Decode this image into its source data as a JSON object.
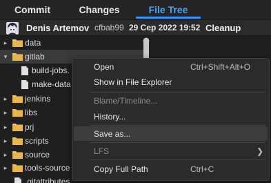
{
  "tabs": [
    {
      "label": "Commit"
    },
    {
      "label": "Changes"
    },
    {
      "label": "File Tree"
    }
  ],
  "commit": {
    "author": "Denis Artemov",
    "hash": "cfbab99",
    "date": "29 Cep 2022 19:52",
    "message": "Cleanup"
  },
  "tree": [
    {
      "label": "data",
      "type": "folder",
      "expanded": false
    },
    {
      "label": "gitlab",
      "type": "folder",
      "expanded": true
    },
    {
      "label": "build-jobs.",
      "type": "file"
    },
    {
      "label": "make-data",
      "type": "file"
    },
    {
      "label": "jenkins",
      "type": "folder",
      "expanded": false
    },
    {
      "label": "libs",
      "type": "folder",
      "expanded": false
    },
    {
      "label": "prj",
      "type": "folder",
      "expanded": false
    },
    {
      "label": "scripts",
      "type": "folder",
      "expanded": false
    },
    {
      "label": "source",
      "type": "folder",
      "expanded": false
    },
    {
      "label": "tools-source",
      "type": "folder",
      "expanded": false
    },
    {
      "label": ".gitattributes",
      "type": "file"
    }
  ],
  "context_menu": {
    "open": {
      "label": "Open",
      "shortcut": "Ctrl+Shift+Alt+O"
    },
    "show_in_explorer": {
      "label": "Show in File Explorer"
    },
    "blame": {
      "label": "Blame/Timeline..."
    },
    "history": {
      "label": "History..."
    },
    "save_as": {
      "label": "Save as..."
    },
    "lfs": {
      "label": "LFS"
    },
    "copy_full_path": {
      "label": "Copy Full Path",
      "shortcut": "Ctrl+C"
    }
  },
  "colors": {
    "accent": "#3794ff",
    "folder": "#f2c55c",
    "background": "#1f1f1f"
  }
}
